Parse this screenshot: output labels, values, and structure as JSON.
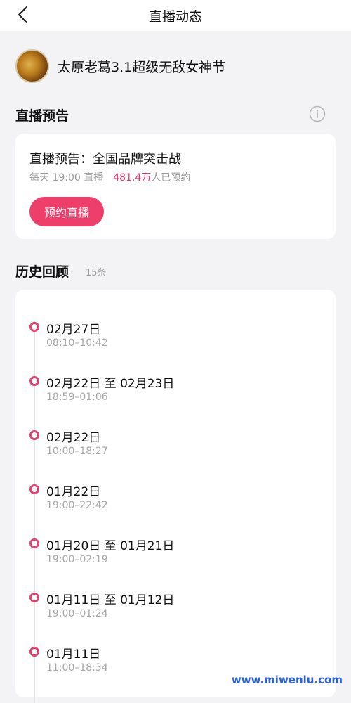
{
  "header": {
    "title": "直播动态",
    "back_icon": "chevron-left-icon"
  },
  "profile": {
    "name": "太原老葛3.1超级无敌女神节"
  },
  "preview_section": {
    "title": "直播预告",
    "info_icon": "info-circle-icon",
    "card": {
      "title": "直播预告：全国品牌突击战",
      "schedule": "每天 19:00 直播",
      "count_number": "481.4万",
      "count_suffix": "人已预约",
      "button_label": "预约直播"
    }
  },
  "history": {
    "title": "历史回顾",
    "count": "15条",
    "items": [
      {
        "date": "02月27日",
        "time": "08:10–10:42"
      },
      {
        "date": "02月22日 至 02月23日",
        "time": "18:59–01:06"
      },
      {
        "date": "02月22日",
        "time": "10:00–18:27"
      },
      {
        "date": "01月22日",
        "time": "19:00–22:42"
      },
      {
        "date": "01月20日 至 01月21日",
        "time": "19:00–02:19"
      },
      {
        "date": "01月11日 至 01月12日",
        "time": "19:00–01:24"
      },
      {
        "date": "01月11日",
        "time": "11:00–18:34"
      }
    ]
  },
  "watermark": "www.miwenlu.com",
  "colors": {
    "accent": "#ee3f6a",
    "count": "#e8356d",
    "timeline_dot": "#e3426e",
    "watermark": "#2b62d8"
  }
}
